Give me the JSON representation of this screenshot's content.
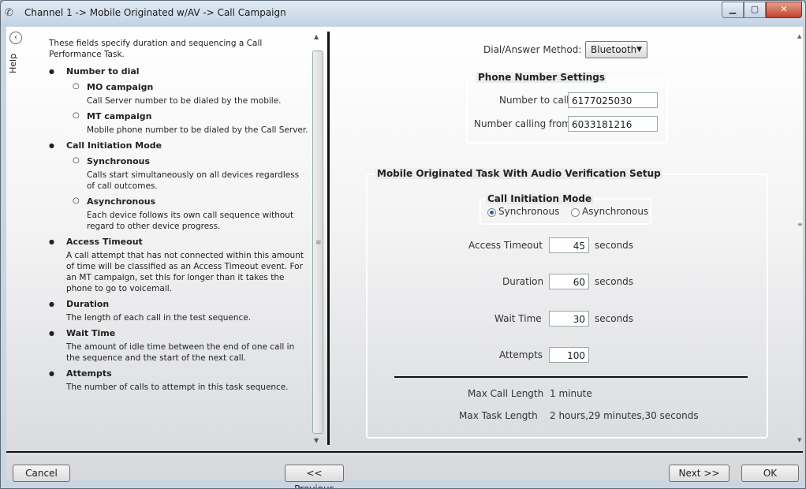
{
  "window": {
    "title": "Channel 1 -> Mobile Originated w/AV -> Call Campaign"
  },
  "help": {
    "tab_label": "Help",
    "intro": "These fields specify duration and sequencing a Call Performance Task.",
    "number_to_dial": "Number to dial",
    "mo_campaign": "MO campaign",
    "mo_campaign_desc": "Call Server number to be dialed by the mobile.",
    "mt_campaign": "MT campaign",
    "mt_campaign_desc": "Mobile phone number to be dialed by the Call Server.",
    "call_initiation_mode": "Call Initiation Mode",
    "synchronous": "Synchronous",
    "synchronous_desc": "Calls start simultaneously on all devices regardless of call outcomes.",
    "asynchronous": "Asynchronous",
    "asynchronous_desc": "Each device follows its own call sequence without regard to other device progress.",
    "access_timeout": "Access Timeout",
    "access_timeout_desc": "A call attempt that has not connected within this amount of time will be classified as an Access Timeout event.  For an MT campaign, set this for longer than it takes the phone to go to voicemail.",
    "duration": "Duration",
    "duration_desc": "The length of each call in the test sequence.",
    "wait_time": "Wait Time",
    "wait_time_desc": "The amount of idle time between the end of one call in the sequence and the start of the next call.",
    "attempts": "Attempts",
    "attempts_desc": "The number of calls to attempt in this task sequence."
  },
  "settings": {
    "dial_method_label": "Dial/Answer Method:",
    "dial_method_value": "Bluetooth",
    "phone_group_title": "Phone Number Settings",
    "number_to_call_label": "Number to call:",
    "number_to_call_value": "6177025030",
    "number_calling_from_label": "Number calling from:",
    "number_calling_from_value": "6033181216",
    "setup_group_title": "Mobile Originated Task With Audio Verification Setup",
    "mode_group_title": "Call Initiation Mode",
    "mode_sync_label": "Synchronous",
    "mode_async_label": "Asynchronous",
    "access_timeout_label": "Access Timeout",
    "access_timeout_value": "45",
    "duration_label": "Duration",
    "duration_value": "60",
    "wait_time_label": "Wait Time",
    "wait_time_value": "30",
    "attempts_label": "Attempts",
    "attempts_value": "100",
    "seconds_unit": "seconds",
    "max_call_length_label": "Max Call Length",
    "max_call_length_value": "1 minute",
    "max_task_length_label": "Max Task Length",
    "max_task_length_value": "2 hours,29 minutes,30 seconds"
  },
  "buttons": {
    "cancel": "Cancel",
    "previous": "<< Previous",
    "next": "Next >>",
    "ok": "OK"
  }
}
